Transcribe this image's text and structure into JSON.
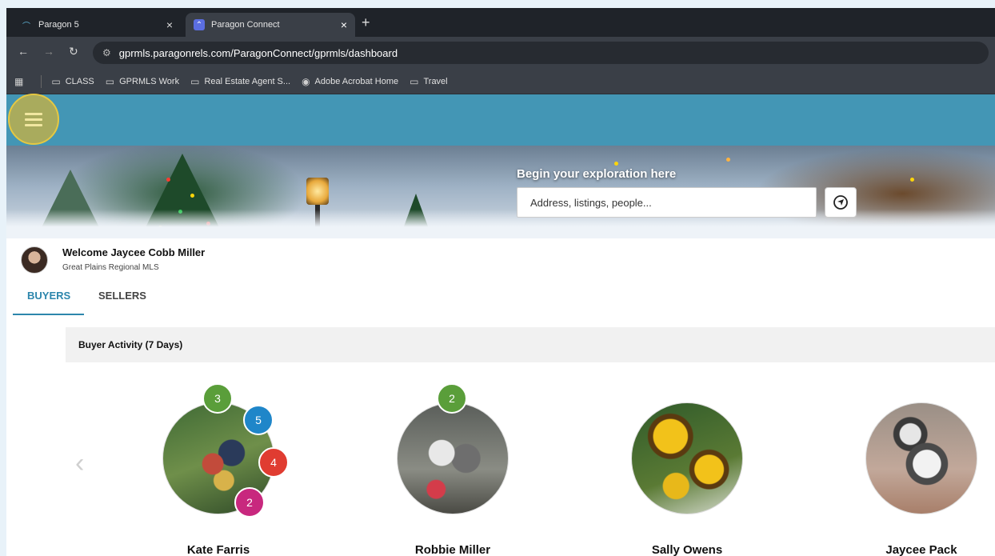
{
  "browser": {
    "tabs": [
      {
        "title": "Paragon 5",
        "active": false
      },
      {
        "title": "Paragon Connect",
        "active": true
      }
    ],
    "new_tab": "+",
    "url": "gprmls.paragonrels.com/ParagonConnect/gprmls/dashboard",
    "bookmarks": [
      {
        "label": "CLASS",
        "icon": "folder-icon"
      },
      {
        "label": "GPRMLS Work",
        "icon": "folder-icon"
      },
      {
        "label": "Real Estate Agent S...",
        "icon": "folder-icon"
      },
      {
        "label": "Adobe Acrobat Home",
        "icon": "globe-icon"
      },
      {
        "label": "Travel",
        "icon": "folder-icon"
      }
    ]
  },
  "hero": {
    "title": "Begin your exploration here",
    "search_placeholder": "Address, listings, people..."
  },
  "welcome": {
    "name": "Welcome Jaycee Cobb Miller",
    "org": "Great Plains Regional MLS"
  },
  "tabs": [
    {
      "label": "BUYERS",
      "active": true
    },
    {
      "label": "SELLERS",
      "active": false
    }
  ],
  "activity": {
    "header": "Buyer Activity (7 Days)",
    "buyers": [
      {
        "name": "Kate Farris",
        "badges": [
          {
            "value": "3",
            "color": "#5a9e3a"
          },
          {
            "value": "5",
            "color": "#1f86c9"
          },
          {
            "value": "4",
            "color": "#e03c31"
          },
          {
            "value": "2",
            "color": "#c8287e"
          }
        ]
      },
      {
        "name": "Robbie Miller",
        "badges": [
          {
            "value": "2",
            "color": "#5a9e3a"
          }
        ]
      },
      {
        "name": "Sally Owens",
        "badges": []
      },
      {
        "name": "Jaycee Pack",
        "badges": []
      }
    ]
  },
  "colors": {
    "appbar": "#4396b5",
    "accent": "#2d86ac",
    "highlight": "#e5c842"
  }
}
